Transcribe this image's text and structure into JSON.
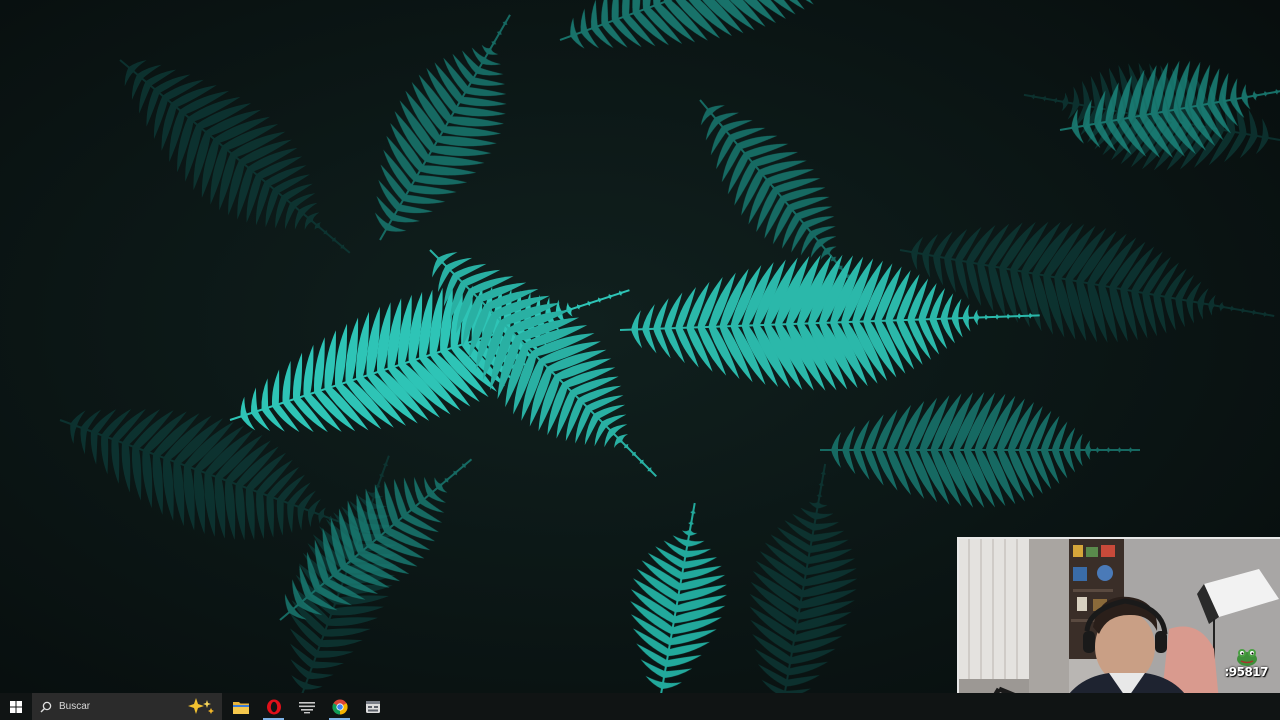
{
  "desktop": {
    "wallpaper": "fern-leaves-dark-teal",
    "colors": {
      "background": "#0b1514",
      "fern_bright": "#2ec4b6",
      "fern_dim": "#0f4a45"
    }
  },
  "taskbar": {
    "start_icon": "windows-logo-icon",
    "search": {
      "placeholder": "Buscar",
      "icon": "search-icon",
      "highlight_icon": "sparkle-icon"
    },
    "apps": [
      {
        "name": "file-explorer",
        "icon": "folder-icon",
        "active": false
      },
      {
        "name": "opera",
        "icon": "opera-icon",
        "active": true
      },
      {
        "name": "stream-tool",
        "icon": "app-icon",
        "active": false
      },
      {
        "name": "chrome",
        "icon": "chrome-icon",
        "active": true
      },
      {
        "name": "calculator",
        "icon": "window-app-icon",
        "active": false
      }
    ]
  },
  "webcam": {
    "counter_text": ":95817"
  }
}
